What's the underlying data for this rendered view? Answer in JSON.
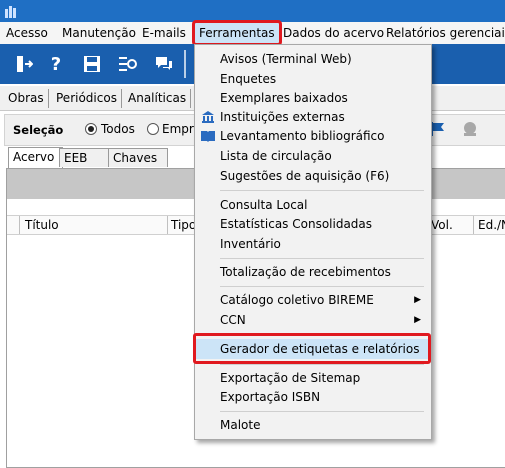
{
  "menubar": {
    "items": [
      "Acesso",
      "Manutenção",
      "E-mails",
      "Ferramentas",
      "Dados do acervo",
      "Relatórios gerenciais"
    ]
  },
  "toolbar": {
    "buttons": [
      "exit-icon",
      "help-icon",
      "save-icon",
      "settings-icon",
      "chat-icon"
    ]
  },
  "tabs_top": [
    "Obras",
    "Periódicos",
    "Analíticas"
  ],
  "selection": {
    "label": "Seleção",
    "option_all": "Todos",
    "option_other": "Empre"
  },
  "tabs_sub": [
    "Acervo",
    "EEB",
    "Chaves"
  ],
  "grid": {
    "columns": [
      "Título",
      "Tipo",
      "Vol.",
      "Ed./N"
    ]
  },
  "dropdown": {
    "groups": [
      [
        "Avisos (Terminal Web)",
        "Enquetes",
        "Exemplares baixados",
        "Instituições externas",
        "Levantamento bibliográfico",
        "Lista de circulação",
        "Sugestões de aquisição (F6)"
      ],
      [
        "Consulta Local",
        "Estatísticas Consolidadas",
        "Inventário"
      ],
      [
        "Totalização de recebimentos"
      ],
      [
        "Catálogo coletivo BIREME",
        "CCN"
      ],
      [
        "Gerador de etiquetas e relatórios"
      ],
      [
        "Exportação de Sitemap",
        "Exportação ISBN"
      ],
      [
        "Malote"
      ]
    ]
  },
  "colors": {
    "titlebar": "#1f6fc4",
    "toolbar": "#1a5fae",
    "highlight": "#cce4f7",
    "annotation_red": "#e0191f"
  }
}
